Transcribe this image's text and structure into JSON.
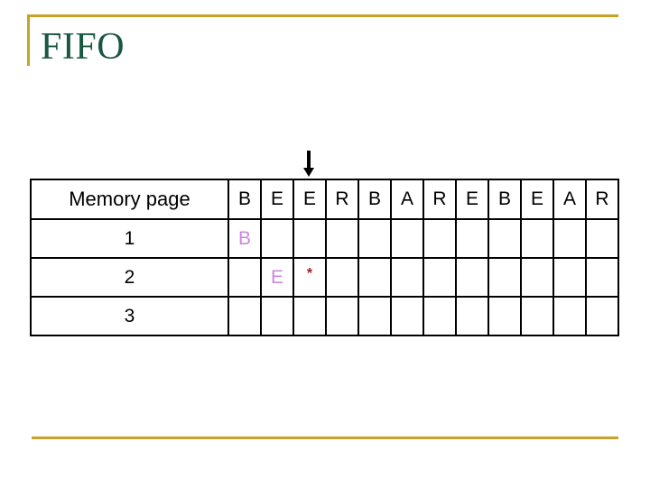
{
  "slide": {
    "title": "FIFO",
    "title_color": "#1a5740",
    "accent_color": "#c9a227",
    "background_color": "#ffffff"
  },
  "pointer": {
    "icon": "down-arrow-icon",
    "points_to_column_index": 2
  },
  "table": {
    "row_label_header": "Memory page",
    "reference_string": [
      "B",
      "E",
      "E",
      "R",
      "B",
      "A",
      "R",
      "E",
      "B",
      "E",
      "A",
      "R"
    ],
    "frame_labels": [
      "1",
      "2",
      "3"
    ],
    "letter_color": "#cc88dd",
    "fault_color": "#aa1a22",
    "rows": [
      {
        "label": "1",
        "cells": [
          "B",
          "",
          "",
          "",
          "",
          "",
          "",
          "",
          "",
          "",
          "",
          ""
        ]
      },
      {
        "label": "2",
        "cells": [
          "",
          "E",
          "*",
          "",
          "",
          "",
          "",
          "",
          "",
          "",
          "",
          ""
        ]
      },
      {
        "label": "3",
        "cells": [
          "",
          "",
          "",
          "",
          "",
          "",
          "",
          "",
          "",
          "",
          "",
          ""
        ]
      }
    ]
  }
}
